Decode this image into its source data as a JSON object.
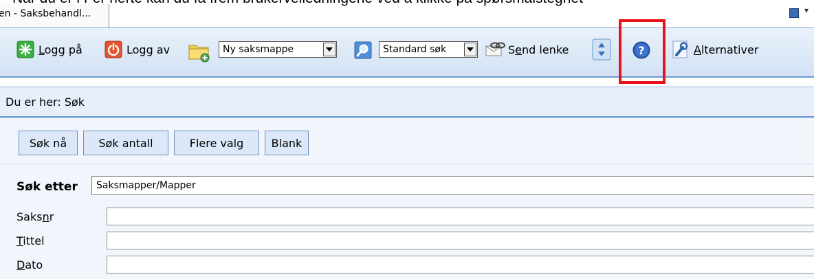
{
  "instruction_text": "Når du er i Fer herte kan du få frem brukerveiledningene ved å klikke på spørsmålstegnet",
  "window_tab": {
    "title": "en - Saksbehandl..."
  },
  "toolbar": {
    "login_label": "Logg på",
    "login_underline": "L",
    "logout_label": "Logg av",
    "new_folder_select": "Ny saksmappe",
    "search_type_select": "Standard søk",
    "send_link_pre": "S",
    "send_link_u": "e",
    "send_link_post": "nd lenke",
    "options_u": "A",
    "options_rest": "lternativer",
    "icons": [
      "login-icon",
      "logout-icon",
      "new-folder-icon",
      "search-icon",
      "send-link-icon",
      "scroll-updown-icon",
      "help-icon",
      "options-wrench-icon"
    ],
    "highlight_color": "#e8121b"
  },
  "breadcrumb": {
    "text": "Du er her: Søk"
  },
  "buttons": {
    "search_now": "Søk nå",
    "search_count": "Søk antall",
    "more_options": "Flere valg",
    "blank": "Blank"
  },
  "search_for": {
    "label": "Søk etter",
    "value": "Saksmapper/Mapper"
  },
  "fields": [
    {
      "pre": "Saks",
      "u": "n",
      "post": "r"
    },
    {
      "pre": "",
      "u": "T",
      "post": "ittel"
    },
    {
      "pre": "",
      "u": "D",
      "post": "ato"
    }
  ]
}
